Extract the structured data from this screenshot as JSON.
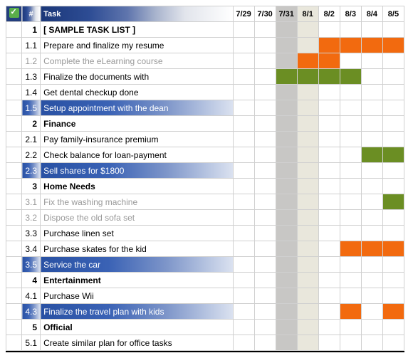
{
  "header": {
    "num_label": "#",
    "task_label": "Task",
    "days": [
      "7/29",
      "7/30",
      "7/31",
      "8/1",
      "8/2",
      "8/3",
      "8/4",
      "8/5"
    ],
    "day_shade": [
      "",
      "",
      "shadeA",
      "shadeB",
      "",
      "",
      "",
      ""
    ]
  },
  "cell_shade_cols": [
    2,
    3
  ],
  "rows": [
    {
      "num": "1",
      "task": "[ SAMPLE TASK LIST ]",
      "group": true
    },
    {
      "num": "1.1",
      "task": "Prepare and finalize my resume",
      "bars": [
        {
          "start": 4,
          "end": 7,
          "color": "orange"
        }
      ]
    },
    {
      "num": "1.2",
      "task": "Complete the eLearning course",
      "completed": true,
      "bars": [
        {
          "start": 3,
          "end": 4,
          "color": "orange"
        }
      ]
    },
    {
      "num": "1.3",
      "task": "Finalize the documents with",
      "bars": [
        {
          "start": 2,
          "end": 5,
          "color": "green"
        }
      ]
    },
    {
      "num": "1.4",
      "task": "Get dental checkup done"
    },
    {
      "num": "1.5",
      "task": "Setup appointment with the dean",
      "highlight": true
    },
    {
      "num": "2",
      "task": "Finance",
      "group": true
    },
    {
      "num": "2.1",
      "task": "Pay family-insurance premium"
    },
    {
      "num": "2.2",
      "task": "Check balance for loan-payment",
      "bars": [
        {
          "start": 6,
          "end": 7,
          "color": "green"
        }
      ]
    },
    {
      "num": "2.3",
      "task": "Sell shares for $1800",
      "highlight": true
    },
    {
      "num": "3",
      "task": "Home Needs",
      "group": true
    },
    {
      "num": "3.1",
      "task": "Fix the washing machine",
      "completed": true,
      "bars": [
        {
          "start": 7,
          "end": 7,
          "color": "green"
        }
      ]
    },
    {
      "num": "3.2",
      "task": "Dispose the old sofa set",
      "completed": true
    },
    {
      "num": "3.3",
      "task": "Purchase linen set"
    },
    {
      "num": "3.4",
      "task": "Purchase skates for the kid",
      "bars": [
        {
          "start": 5,
          "end": 7,
          "color": "orange"
        }
      ]
    },
    {
      "num": "3.5",
      "task": "Service the car",
      "highlight": true
    },
    {
      "num": "4",
      "task": "Entertainment",
      "group": true
    },
    {
      "num": "4.1",
      "task": "Purchase Wii"
    },
    {
      "num": "4.3",
      "task": "Finalize the travel plan with kids",
      "highlight": true,
      "bars": [
        {
          "start": 5,
          "end": 5,
          "color": "orange"
        },
        {
          "start": 7,
          "end": 7,
          "color": "orange"
        }
      ]
    },
    {
      "num": "5",
      "task": "Official",
      "group": true
    },
    {
      "num": "5.1",
      "task": "Create similar plan for office tasks"
    }
  ]
}
